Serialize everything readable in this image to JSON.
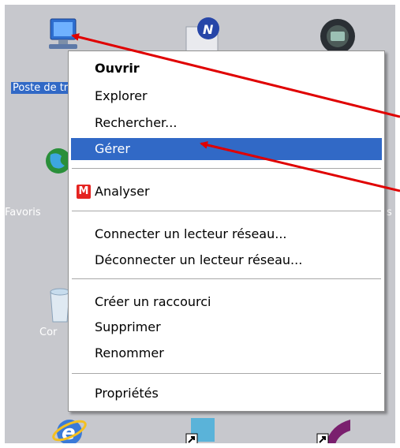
{
  "desktop": {
    "icons": [
      {
        "name": "my-computer-icon",
        "label": "Poste de travail"
      },
      {
        "name": "favorites-icon",
        "label": "Favoris"
      },
      {
        "name": "recycle-bin-icon",
        "label": "Cor"
      },
      {
        "name": "internet-explorer-icon",
        "label": ""
      }
    ],
    "right_label_1": "s"
  },
  "context_menu": {
    "items": [
      {
        "label": "Ouvrir",
        "bold": true
      },
      {
        "label": "Explorer"
      },
      {
        "label": "Rechercher..."
      },
      {
        "label": "Gérer",
        "highlighted": true
      },
      {
        "label": "Analyser",
        "icon": "mcafee-m-icon",
        "icon_text": "M"
      },
      {
        "label": "Connecter un lecteur réseau..."
      },
      {
        "label": "Déconnecter un lecteur réseau..."
      },
      {
        "label": "Créer un raccourci"
      },
      {
        "label": "Supprimer"
      },
      {
        "label": "Renommer"
      },
      {
        "label": "Propriétés"
      }
    ]
  },
  "colors": {
    "desktop_bg": "#c7c8cd",
    "highlight": "#3169c6",
    "annotation_arrow": "#e00000"
  }
}
